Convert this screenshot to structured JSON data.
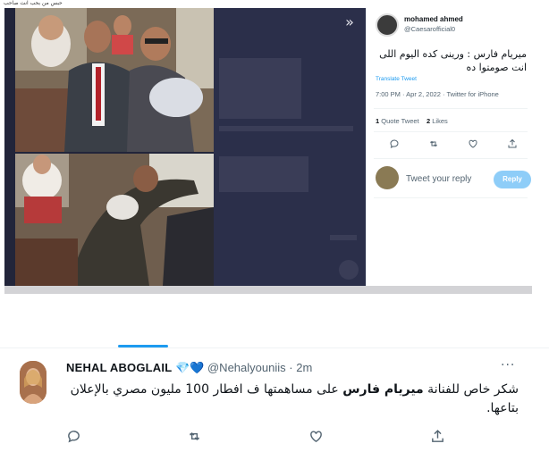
{
  "top_strip": {
    "text": "حبس من بحب انت صاحب"
  },
  "panel": {
    "author_name": "mohamed ahmed",
    "author_handle": "@Caesarofficial0",
    "text": "ميريام فارس : ورينى كده اليوم اللى انت صومتوا ده",
    "translate_label": "Translate Tweet",
    "meta": "7:00 PM · Apr 2, 2022 · Twitter for iPhone",
    "quote_count": "1",
    "quote_label": "Quote Tweet",
    "likes_count": "2",
    "likes_label": "Likes",
    "reply_placeholder": "Tweet your reply",
    "reply_button": "Reply",
    "icons": [
      "reply-icon",
      "retweet-icon",
      "like-icon",
      "share-icon",
      "collapse-icon"
    ]
  },
  "tweet": {
    "author_name": "NEHAL ABOGLAIL",
    "badges": "💎💙",
    "handle": "@Nehalyouniis",
    "separator": "·",
    "time": "2m",
    "more": "···",
    "text_part1": "شكر خاص للفنانة ",
    "text_bold": "ميريام فارس",
    "text_part2": " على مساهمتها ف افطار 100 مليون مصري بالإعلان بتاعها.",
    "icons": [
      "reply-icon",
      "retweet-icon",
      "like-icon",
      "share-icon"
    ]
  },
  "colors": {
    "accent": "#1d9bf0",
    "dim_overlay": "#2b2f4a",
    "text_primary": "#0f1419",
    "text_secondary": "#536471",
    "reply_button_bg": "#8ecdf8"
  }
}
